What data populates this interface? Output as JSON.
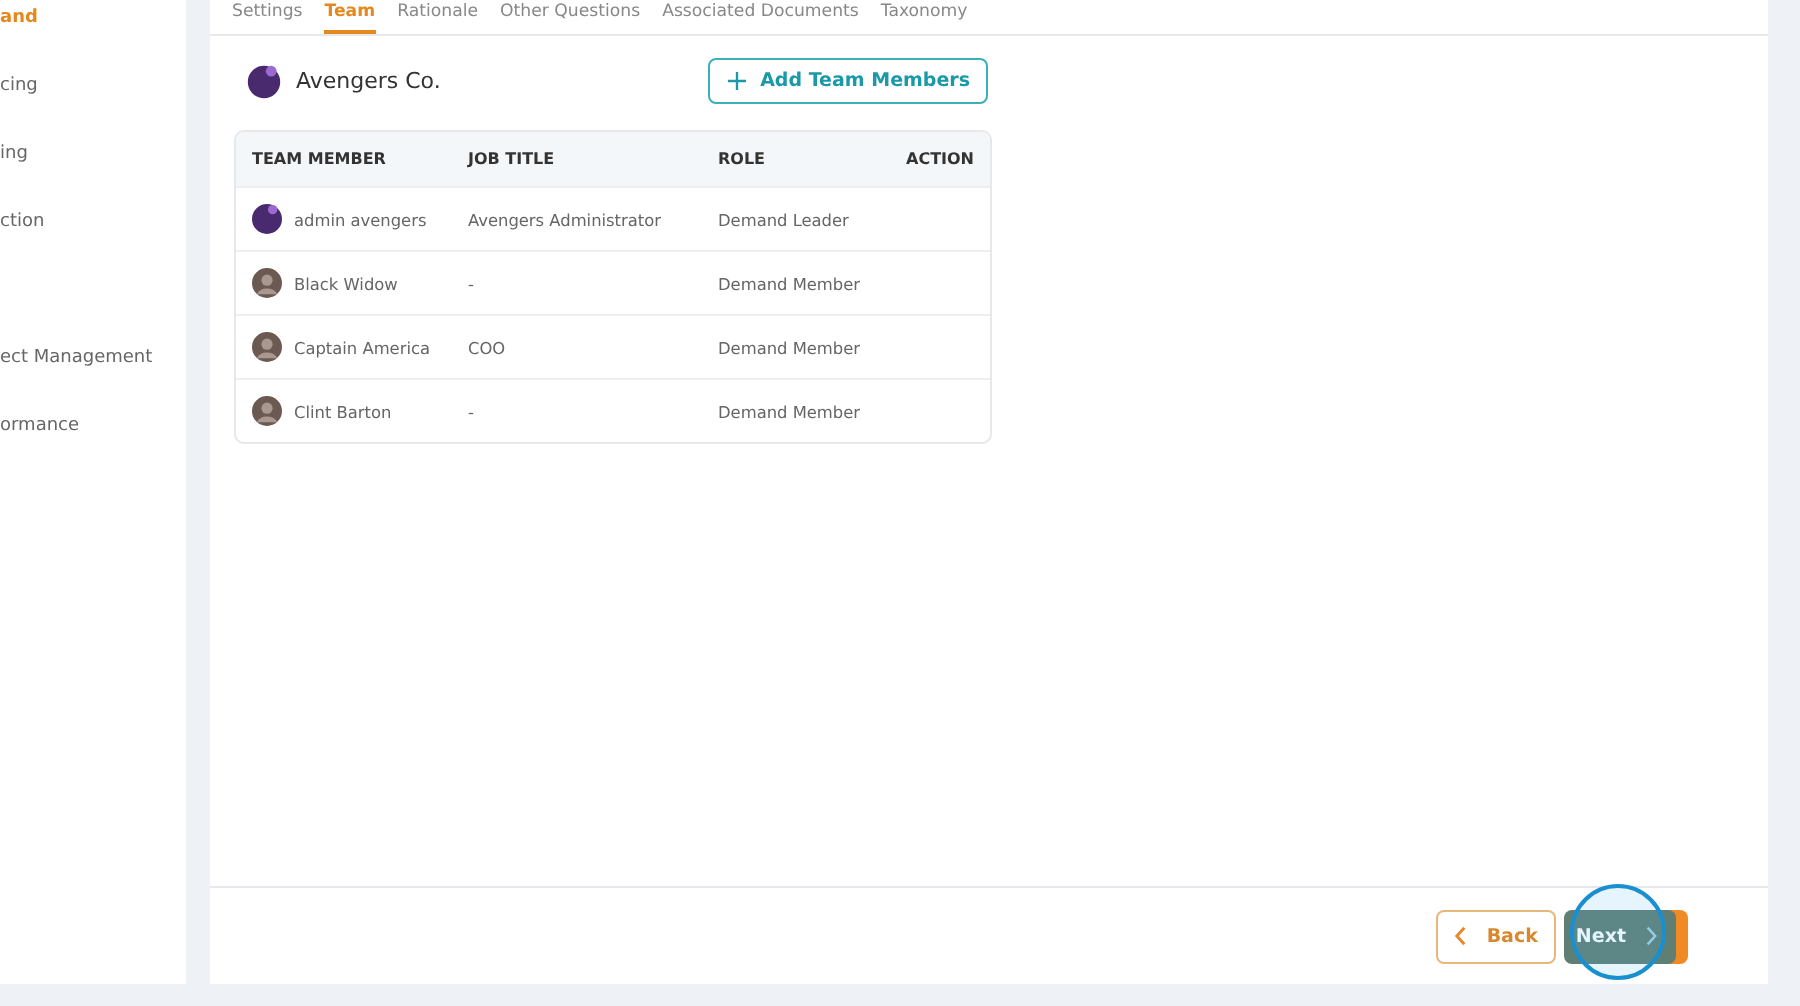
{
  "sidebar": {
    "items": [
      {
        "label": "and",
        "selected": true
      },
      {
        "label": "cing",
        "selected": false
      },
      {
        "label": "ing",
        "selected": false
      },
      {
        "label": "ction",
        "selected": false
      },
      {
        "label": "ect Management",
        "selected": false
      },
      {
        "label": "ormance",
        "selected": false
      }
    ]
  },
  "tabs": [
    {
      "label": "Settings",
      "selected": false
    },
    {
      "label": "Team",
      "selected": true
    },
    {
      "label": "Rationale",
      "selected": false
    },
    {
      "label": "Other Questions",
      "selected": false
    },
    {
      "label": "Associated Documents",
      "selected": false
    },
    {
      "label": "Taxonomy",
      "selected": false
    }
  ],
  "team": {
    "name": "Avengers Co.",
    "add_button": "Add Team Members"
  },
  "table": {
    "columns": [
      "TEAM MEMBER",
      "JOB TITLE",
      "ROLE",
      "ACTION"
    ],
    "rows": [
      {
        "member": "admin avengers",
        "job_title": "Avengers Administrator",
        "role": "Demand Leader",
        "kind": "logo"
      },
      {
        "member": "Black Widow",
        "job_title": "-",
        "role": "Demand Member",
        "kind": "photo"
      },
      {
        "member": "Captain America",
        "job_title": "COO",
        "role": "Demand Member",
        "kind": "photo"
      },
      {
        "member": "Clint Barton",
        "job_title": "-",
        "role": "Demand Member",
        "kind": "photo"
      }
    ]
  },
  "footer": {
    "back": "Back",
    "next": "Next"
  }
}
